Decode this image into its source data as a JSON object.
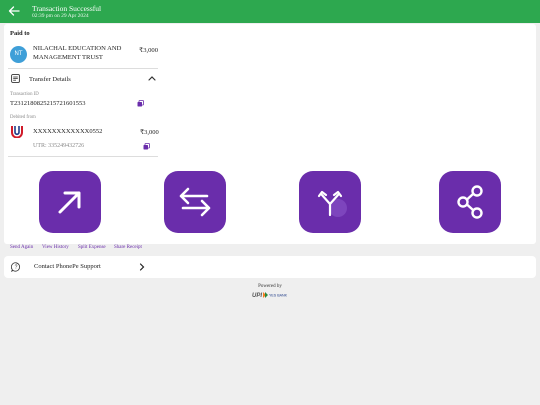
{
  "header": {
    "title": "Transaction Successful",
    "subtitle": "02:39 pm on 29 Apr 2024"
  },
  "paid_to": {
    "label": "Paid to",
    "avatar_initials": "NT",
    "name": "NILACHAL EDUCATION AND MANAGEMENT TRUST",
    "amount": "₹3,000"
  },
  "transfer_details": {
    "label": "Transfer Details",
    "transaction_id_label": "Transaction ID",
    "transaction_id": "T2312180825215721601553",
    "debited_from_label": "Debited from",
    "account_number": "XXXXXXXXXXXX0552",
    "account_amount": "₹3,000",
    "utr": "UTR: 335249432726"
  },
  "actions": [
    {
      "label": "Send Again",
      "icon": "arrow-up-right-icon"
    },
    {
      "label": "View History",
      "icon": "swap-arrows-icon"
    },
    {
      "label": "Split Expense",
      "icon": "split-arrows-icon"
    },
    {
      "label": "Share Receipt",
      "icon": "share-icon"
    }
  ],
  "support": {
    "label": "Contact PhonePe Support"
  },
  "footer": {
    "powered_by": "Powered by",
    "logo_text": "UPI",
    "bank_text": "YES BANK"
  },
  "colors": {
    "header_green": "#2da84f",
    "brand_purple": "#6a2dab",
    "avatar_blue": "#3f9fd8"
  }
}
